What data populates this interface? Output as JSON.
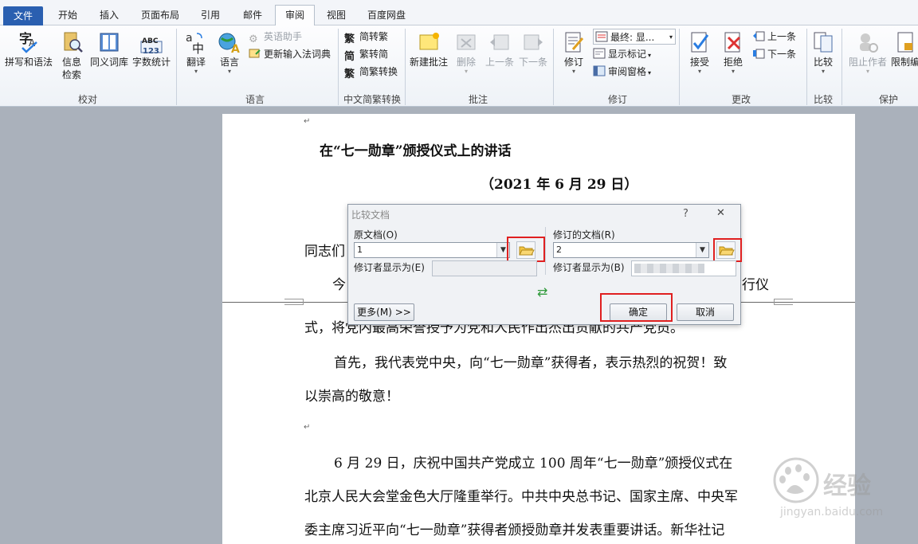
{
  "tabs": [
    {
      "label": "文件",
      "kind": "file"
    },
    {
      "label": "开始"
    },
    {
      "label": "插入"
    },
    {
      "label": "页面布局"
    },
    {
      "label": "引用"
    },
    {
      "label": "邮件"
    },
    {
      "label": "审阅",
      "kind": "active"
    },
    {
      "label": "视图"
    },
    {
      "label": "百度网盘"
    }
  ],
  "ribbon": {
    "proof": {
      "group": "校对",
      "spell": "拼写和语法",
      "research": "信息",
      "research2": "检索",
      "thesaurus": "同义词库",
      "wordcount": "字数统计",
      "wordcount_icon_text": "ABC",
      "wordcount_icon_num": "123"
    },
    "lang": {
      "group": "语言",
      "translate": "翻译",
      "language": "语言",
      "english_assist": "英语助手",
      "update_ime": "更新输入法词典"
    },
    "chinese": {
      "group": "中文简繁转换",
      "to_trad": "简转繁",
      "to_simp": "繁转简",
      "convert": "简繁转换",
      "trad_glyph": "繁",
      "simp_glyph": "简"
    },
    "comments": {
      "group": "批注",
      "new": "新建批注",
      "delete": "删除",
      "prev": "上一条",
      "next": "下一条"
    },
    "tracking": {
      "group": "修订",
      "track": "修订",
      "final_show": "最终: 显...",
      "show_markup": "显示标记",
      "review_pane": "审阅窗格"
    },
    "changes": {
      "group": "更改",
      "accept": "接受",
      "reject": "拒绝",
      "prev": "上一条",
      "next": "下一条"
    },
    "compare": {
      "group": "比较",
      "compare": "比较"
    },
    "protect": {
      "group": "保护",
      "block_authors": "阻止作者",
      "restrict": "限制编"
    }
  },
  "document": {
    "title": "在“七一勋章”颁授仪式上的讲话",
    "date": "（2021 年 6 月 29 日）",
    "salutation_partial": "同志们",
    "p1_start": "今",
    "p1_end": "行仪",
    "p1_line2": "式，将党内最高荣誉授予为党和人民作出杰出贡献的共产党员。",
    "p2_line1": "首先，我代表党中央，向“七一勋章”获得者，表示热烈的祝贺！致",
    "p2_line2": "以崇高的敬意！",
    "p3_line1": "6 月 29 日，庆祝中国共产党成立 100 周年“七一勋章”颁授仪式在",
    "p3_line2": "北京人民大会堂金色大厅隆重举行。中共中央总书记、国家主席、中央军",
    "p3_line3": "委主席习近平向“七一勋章”获得者颁授勋章并发表重要讲话。新华社记",
    "para_mark": "↵"
  },
  "dialog": {
    "title": "比较文档",
    "help": "?",
    "close": "✕",
    "original_label": "原文档(O)",
    "original_value": "1",
    "revised_label": "修订的文档(R)",
    "revised_value": "2",
    "label_changes_original": "修订者显示为(E)",
    "label_changes_revised": "修订者显示为(B)",
    "swap": "⇄",
    "more": "更多(M) >>",
    "ok": "确定",
    "cancel": "取消"
  },
  "watermark": {
    "brand": "经验",
    "url": "jingyan.baidu.com",
    "logo_text": "Bai du"
  },
  "colors": {
    "file_tab": "#2a5fb0",
    "highlight": "#e02020",
    "swap_arrow": "#2f9a3a"
  }
}
